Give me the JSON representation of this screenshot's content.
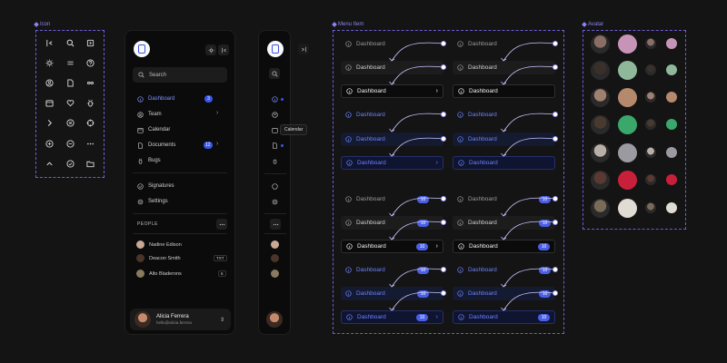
{
  "frames": {
    "icon_label": "Icon",
    "menu_label": "Menu Item",
    "avatar_label": "Avatar"
  },
  "icons": [
    "sidebar-collapse-icon",
    "search-icon",
    "expand-icon",
    "sun-icon",
    "menu-icon",
    "help-icon",
    "user-circle-icon",
    "file-icon",
    "infinity-icon",
    "calendar-icon",
    "heart-icon",
    "bug-icon",
    "chevron-right-icon",
    "x-circle-icon",
    "target-icon",
    "plus-circle-icon",
    "minus-circle-icon",
    "more-icon",
    "chevron-up-icon",
    "check-circle-icon",
    "folder-icon"
  ],
  "sidebar": {
    "search_placeholder": "Search",
    "items": [
      {
        "label": "Dashboard",
        "badge": "3"
      },
      {
        "label": "Team"
      },
      {
        "label": "Calendar"
      },
      {
        "label": "Documents",
        "badge": "12"
      },
      {
        "label": "Bugs"
      }
    ],
    "secondary": [
      {
        "label": "Signatures"
      },
      {
        "label": "Settings"
      }
    ],
    "people_label": "PEOPLE",
    "people": [
      {
        "name": "Nadine Edison"
      },
      {
        "name": "Deacon Smith",
        "tag": "TXT"
      },
      {
        "name": "Alto Bladerons",
        "tag": "6"
      }
    ],
    "user": {
      "name": "Alicia Ferrera",
      "email": "hello@alicia.ferrera"
    }
  },
  "collapsed": {
    "tooltip": "Calendar"
  },
  "menu_item": {
    "label": "Dashboard",
    "badge": "10"
  },
  "colors": {
    "accent": "#3b55e6",
    "background": "#141414",
    "panel": "#0b0b0b"
  }
}
